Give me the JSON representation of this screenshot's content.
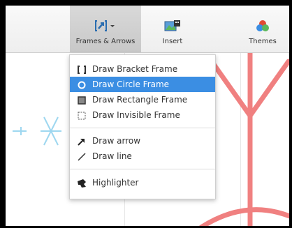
{
  "toolbar": {
    "frames_arrows_label": "Frames & Arrows",
    "insert_label": "Insert",
    "themes_label": "Themes"
  },
  "menu": {
    "items": [
      {
        "label": "Draw Bracket Frame",
        "icon": "bracket-frame-icon"
      },
      {
        "label": "Draw Circle Frame",
        "icon": "circle-frame-icon",
        "selected": true
      },
      {
        "label": "Draw Rectangle Frame",
        "icon": "rectangle-frame-icon"
      },
      {
        "label": "Draw Invisible Frame",
        "icon": "invisible-frame-icon"
      },
      {
        "label": "Draw arrow",
        "icon": "arrow-icon"
      },
      {
        "label": "Draw line",
        "icon": "line-icon"
      },
      {
        "label": "Highlighter",
        "icon": "highlighter-icon"
      }
    ]
  },
  "colors": {
    "selection": "#3b8ee3",
    "canvas_shape": "#f08080",
    "canvas_accent": "#9ed7f0"
  }
}
